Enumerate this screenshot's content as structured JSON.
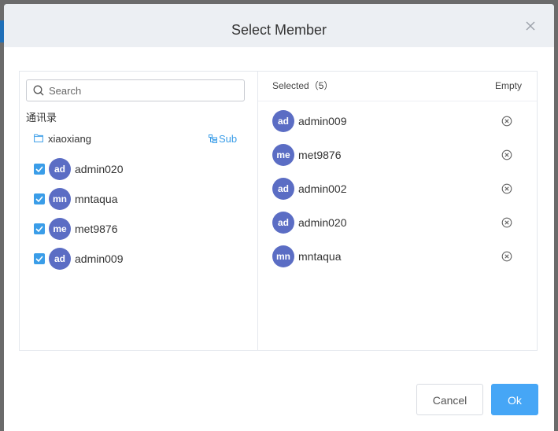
{
  "dialog": {
    "title": "Select Member"
  },
  "search": {
    "placeholder": "Search",
    "value": ""
  },
  "directory": {
    "section_label": "通讯录",
    "department": "xiaoxiang",
    "sub_label": "Sub",
    "members": [
      {
        "initials": "ad",
        "name": "admin020",
        "checked": true
      },
      {
        "initials": "mn",
        "name": "mntaqua",
        "checked": true
      },
      {
        "initials": "me",
        "name": "met9876",
        "checked": true
      },
      {
        "initials": "ad",
        "name": "admin009",
        "checked": true
      }
    ]
  },
  "selected": {
    "label": "Selected（5）",
    "empty_label": "Empty",
    "members": [
      {
        "initials": "ad",
        "name": "admin009"
      },
      {
        "initials": "me",
        "name": "met9876"
      },
      {
        "initials": "ad",
        "name": "admin002"
      },
      {
        "initials": "ad",
        "name": "admin020"
      },
      {
        "initials": "mn",
        "name": "mntaqua"
      }
    ]
  },
  "footer": {
    "cancel_label": "Cancel",
    "ok_label": "Ok"
  },
  "colors": {
    "accent": "#46a6f6",
    "avatar": "#5b6dc4",
    "checkbox": "#3a9de8"
  },
  "icons": {
    "close": "close-icon",
    "search": "search-icon",
    "folder": "folder-icon",
    "sub": "sub-tree-icon",
    "remove": "remove-circle-icon"
  }
}
